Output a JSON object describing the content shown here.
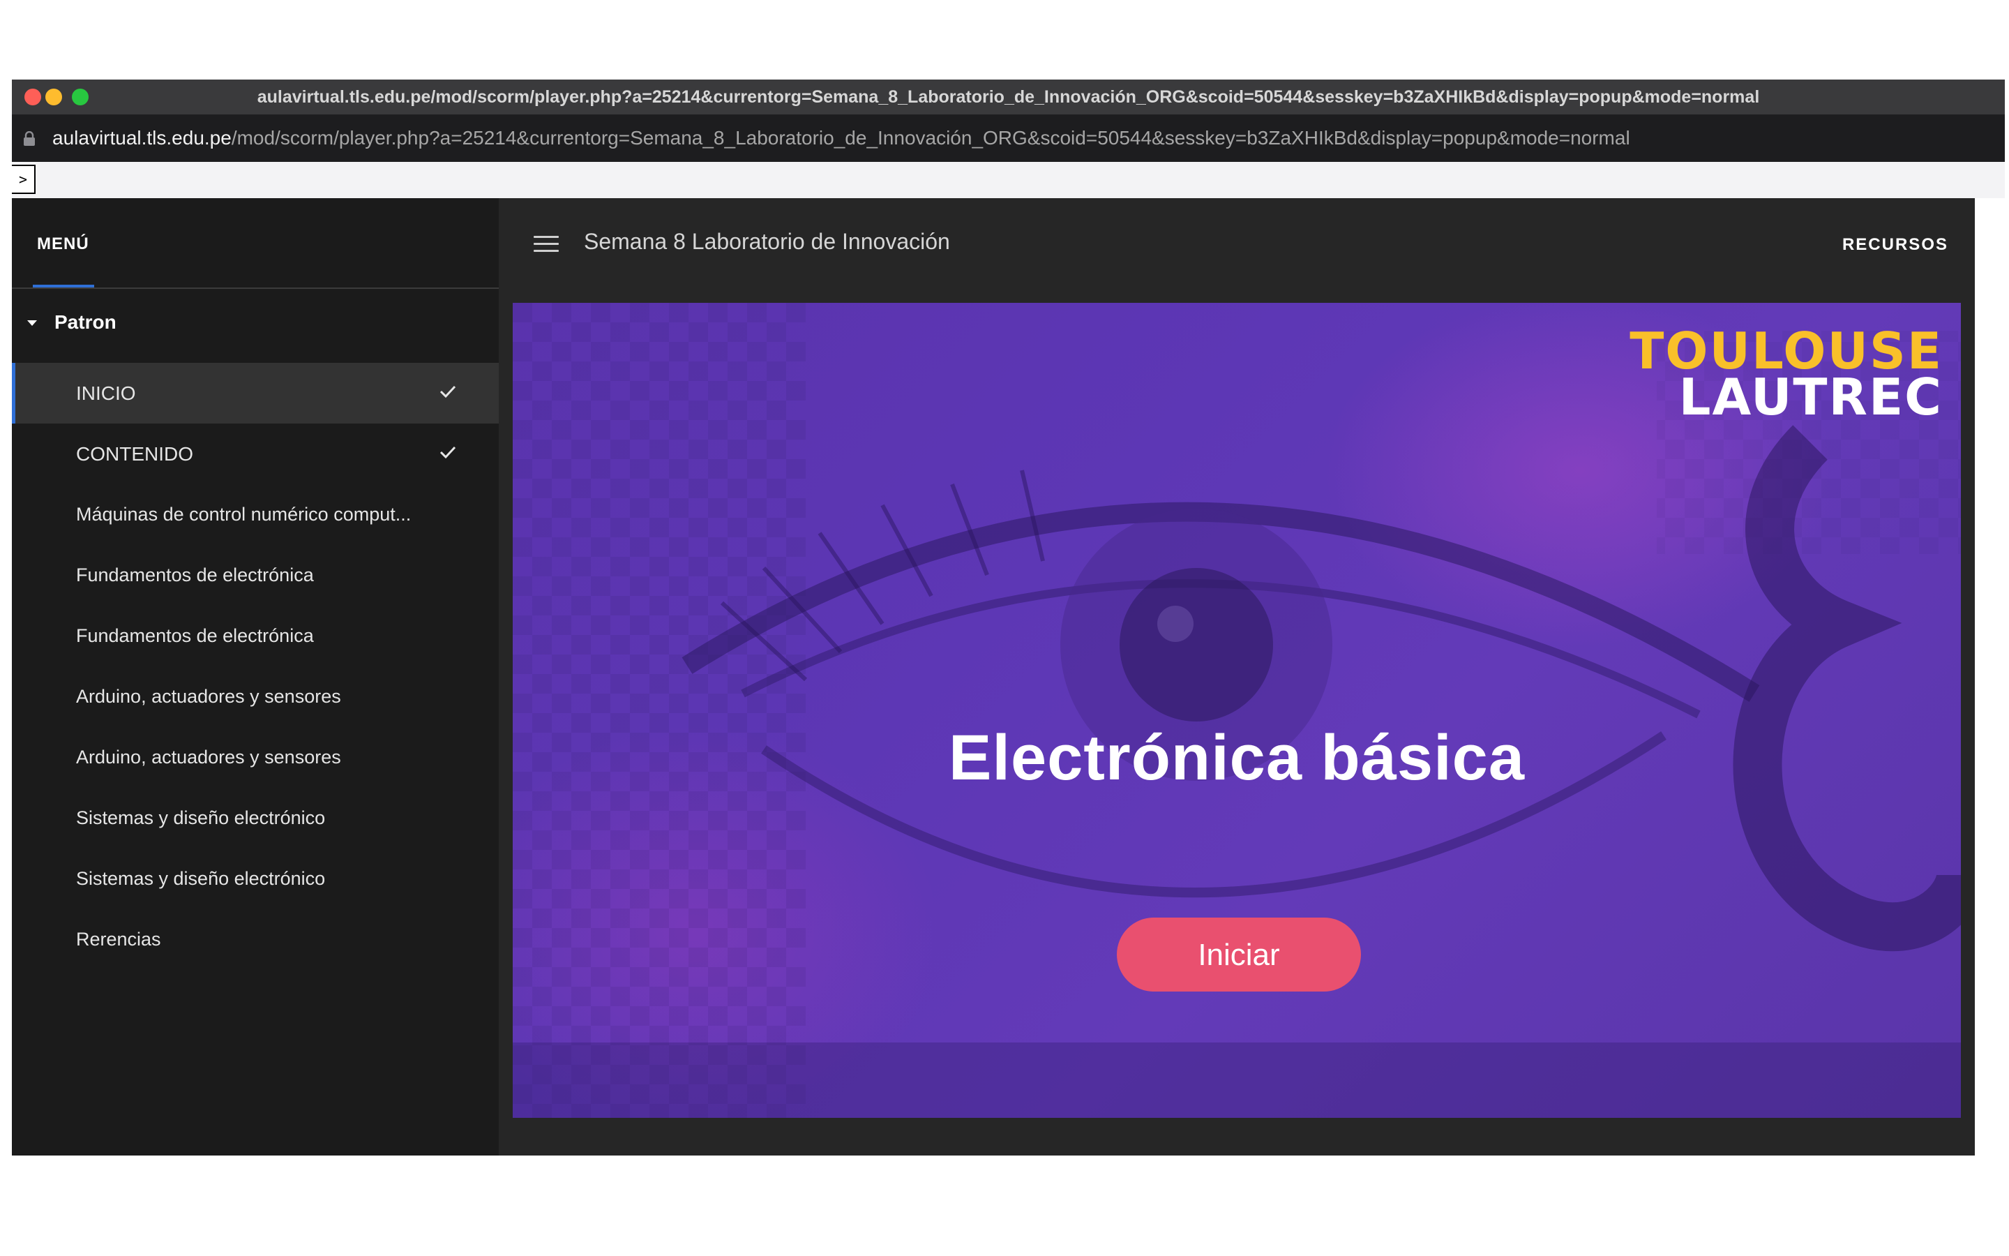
{
  "browser": {
    "window_title": "aulavirtual.tls.edu.pe/mod/scorm/player.php?a=25214&currentorg=Semana_8_Laboratorio_de_Innovación_ORG&scoid=50544&sesskey=b3ZaXHIkBd&display=popup&mode=normal",
    "url_host": "aulavirtual.tls.edu.pe",
    "url_path": "/mod/scorm/player.php?a=25214&currentorg=Semana_8_Laboratorio_de_Innovación_ORG&scoid=50544&sesskey=b3ZaXHIkBd&display=popup&mode=normal",
    "toggle_label": ">"
  },
  "sidebar": {
    "menu_label": "MENÚ",
    "section_label": "Patron",
    "items": [
      {
        "label": "INICIO",
        "completed": true,
        "active": true
      },
      {
        "label": "CONTENIDO",
        "completed": true,
        "active": false
      },
      {
        "label": "Máquinas de control numérico comput...",
        "completed": false,
        "active": false
      },
      {
        "label": "Fundamentos de electrónica",
        "completed": false,
        "active": false
      },
      {
        "label": "Fundamentos de electrónica",
        "completed": false,
        "active": false
      },
      {
        "label": "Arduino, actuadores y sensores",
        "completed": false,
        "active": false
      },
      {
        "label": "Arduino, actuadores y sensores",
        "completed": false,
        "active": false
      },
      {
        "label": "Sistemas y diseño electrónico",
        "completed": false,
        "active": false
      },
      {
        "label": "Sistemas y diseño electrónico",
        "completed": false,
        "active": false
      },
      {
        "label": "Rerencias",
        "completed": false,
        "active": false
      }
    ]
  },
  "header": {
    "course_title": "Semana 8 Laboratorio de Innovación",
    "resources_label": "RECURSOS"
  },
  "hero": {
    "logo_line1": "TOULOUSE",
    "logo_line2": "LAUTREC",
    "title": "Electrónica básica",
    "start_label": "Iniciar"
  },
  "colors": {
    "accent": "#2f6fd6",
    "button": "#e9506f",
    "logo_yellow": "#f9c02a",
    "hero_purple": "#5a33ad"
  }
}
